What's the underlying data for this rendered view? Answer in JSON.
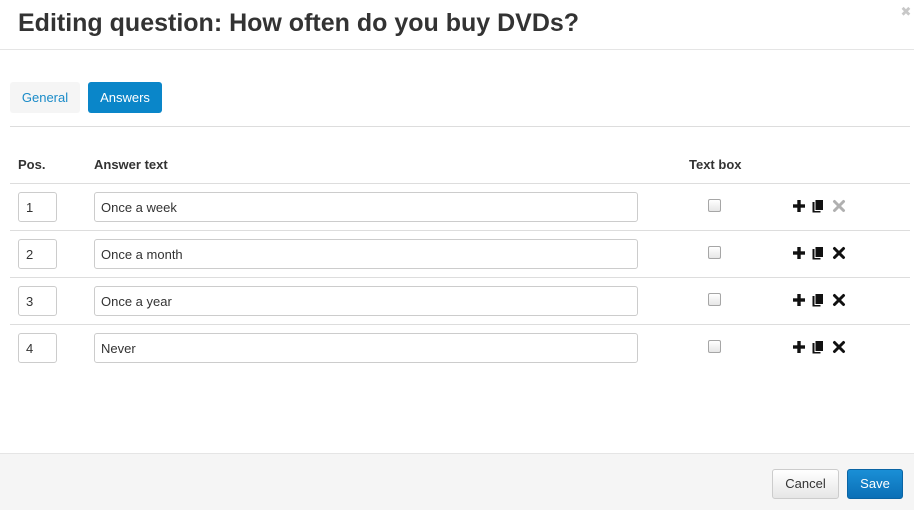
{
  "modal": {
    "title": "Editing question: How often do you buy DVDs?",
    "close_glyph": "✖"
  },
  "tabs": [
    {
      "label": "General",
      "active": false
    },
    {
      "label": "Answers",
      "active": true
    }
  ],
  "table": {
    "headers": {
      "pos": "Pos.",
      "answer_text": "Answer text",
      "text_box": "Text box"
    },
    "rows": [
      {
        "pos": "1",
        "text": "Once a week",
        "text_box": false,
        "delete_enabled": false
      },
      {
        "pos": "2",
        "text": "Once a month",
        "text_box": false,
        "delete_enabled": true
      },
      {
        "pos": "3",
        "text": "Once a year",
        "text_box": false,
        "delete_enabled": true
      },
      {
        "pos": "4",
        "text": "Never",
        "text_box": false,
        "delete_enabled": true
      }
    ],
    "actions": [
      "plus-icon",
      "copy-icon",
      "times-icon"
    ]
  },
  "footer": {
    "cancel_label": "Cancel",
    "save_label": "Save"
  },
  "colors": {
    "primary": "#0a86c9",
    "link": "#1a8bc8",
    "disabled_icon": "#b0b0b0",
    "icon": "#111111"
  }
}
